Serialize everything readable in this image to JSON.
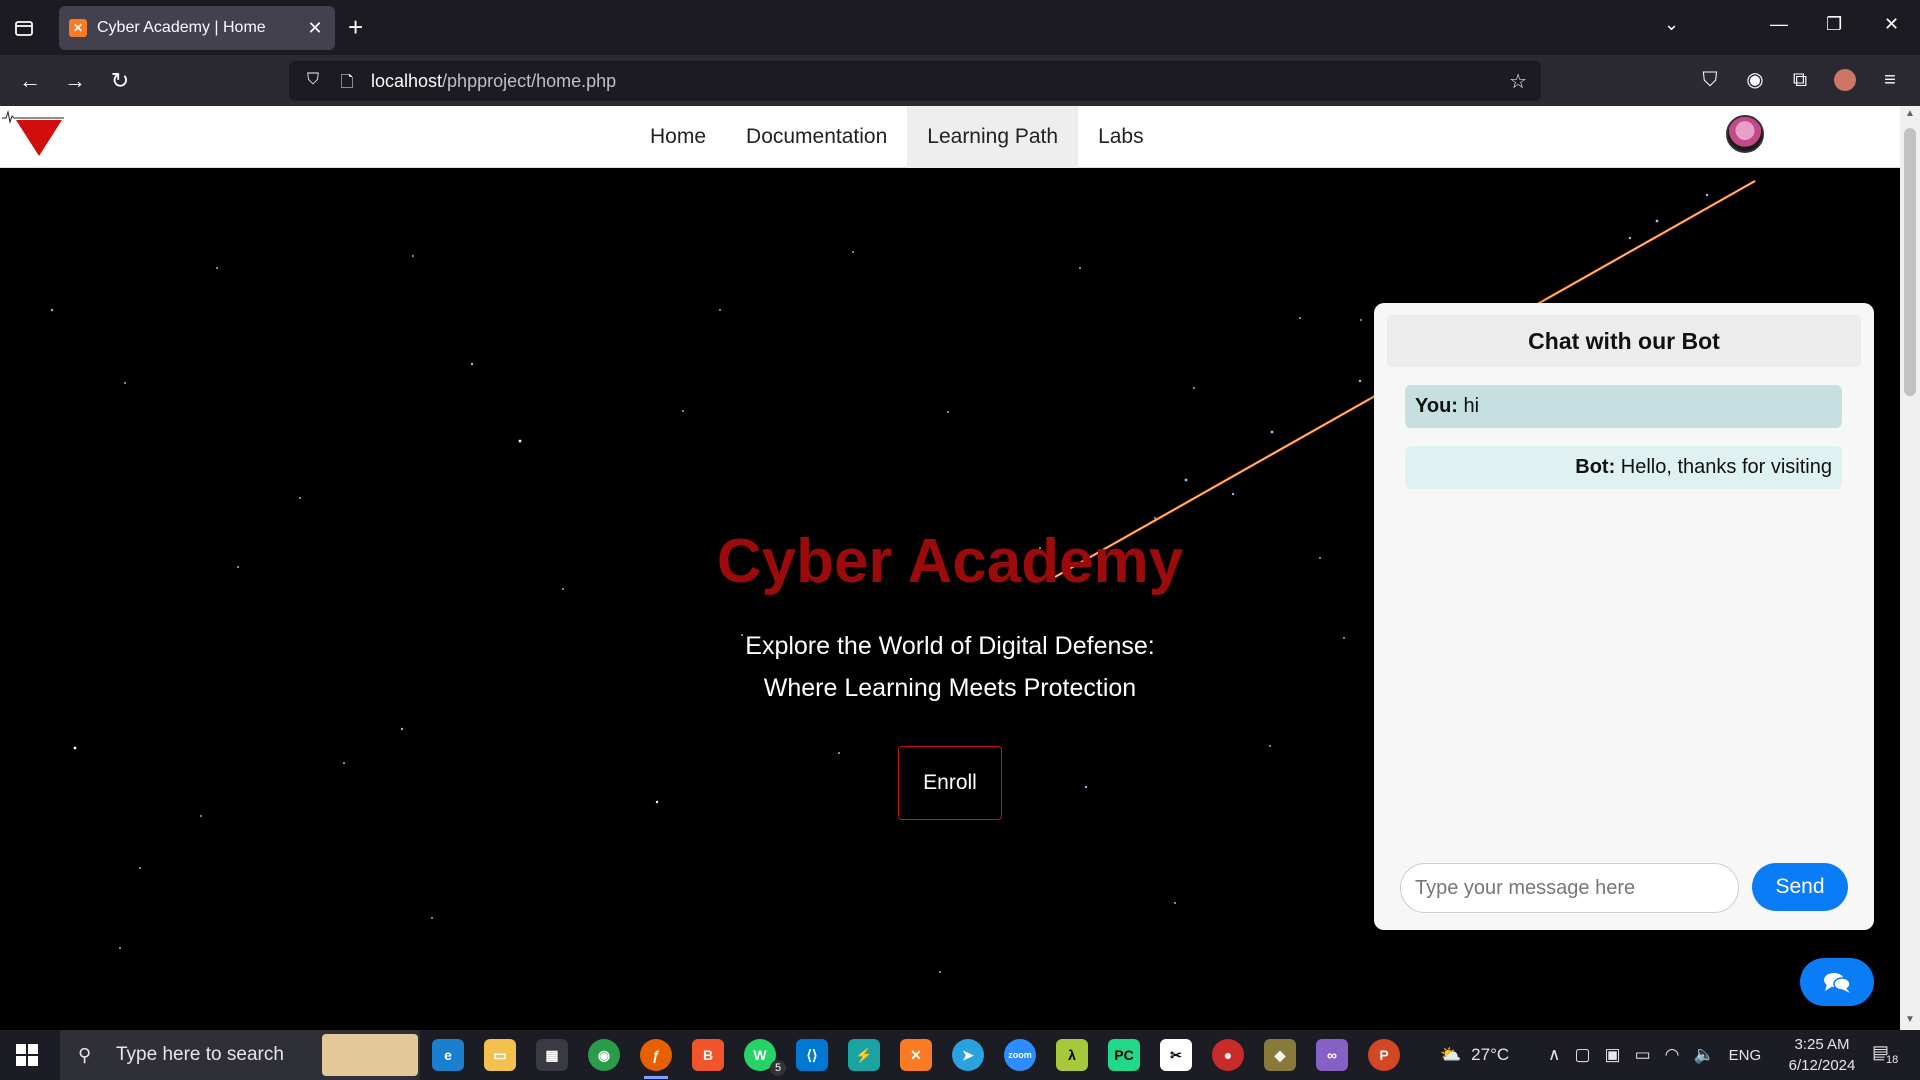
{
  "browser": {
    "tab_title": "Cyber Academy | Home",
    "url_host": "localhost",
    "url_path": "/phpproject/home.php"
  },
  "site": {
    "nav": [
      "Home",
      "Documentation",
      "Learning Path",
      "Labs"
    ],
    "active_nav": "Learning Path",
    "hero_title": "Cyber Academy",
    "hero_line1": "Explore the World of Digital Defense:",
    "hero_line2": "Where Learning Meets Protection",
    "enroll_label": "Enroll"
  },
  "chat": {
    "title": "Chat with our Bot",
    "messages": [
      {
        "sender": "You:",
        "text": "hi"
      },
      {
        "sender": "Bot:",
        "text": "Hello, thanks for visiting"
      }
    ],
    "input_placeholder": "Type your message here",
    "send_label": "Send"
  },
  "taskbar": {
    "search_placeholder": "Type here to search",
    "weather": "27°C",
    "language": "ENG",
    "time": "3:25 AM",
    "date": "6/12/2024",
    "notification_count": "18",
    "whatsapp_badge": "5"
  },
  "colors": {
    "hero_title": "#9b0b0b",
    "send_button": "#0a7cf5",
    "enroll_border": "#cc1111"
  }
}
